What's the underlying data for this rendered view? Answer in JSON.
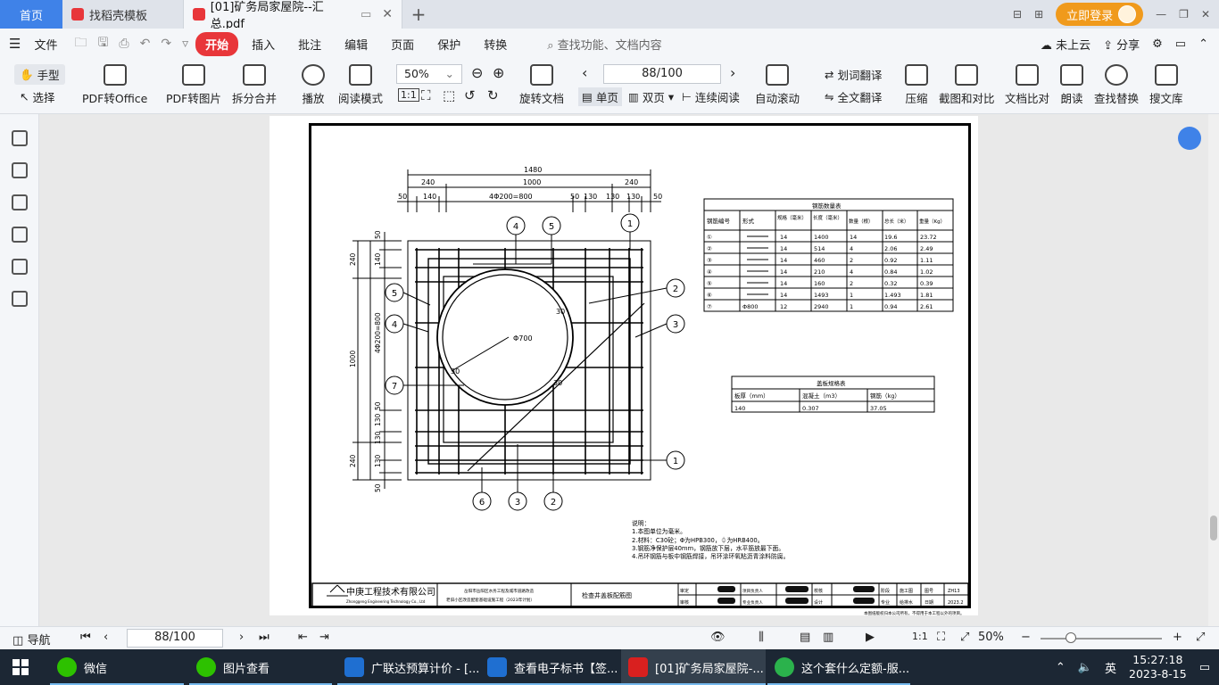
{
  "tabs": {
    "home": "首页",
    "tab1": "找稻壳模板",
    "tab2": "[01]矿务局家屋院--汇总.pdf",
    "login": "立即登录"
  },
  "menu": {
    "file": "文件",
    "items": [
      "开始",
      "插入",
      "批注",
      "编辑",
      "页面",
      "保护",
      "转换"
    ],
    "search": "查找功能、文档内容",
    "cloud": "未上云",
    "share": "分享"
  },
  "toolbar": {
    "hand": "手型",
    "select": "选择",
    "pdf_office": "PDF转Office",
    "pdf_image": "PDF转图片",
    "split": "拆分合并",
    "play": "播放",
    "read_mode": "阅读模式",
    "zoom": "50%",
    "page": "88/100",
    "rotate": "旋转文档",
    "single": "单页",
    "double": "双页",
    "continuous": "连续阅读",
    "autoscroll": "自动滚动",
    "word_trans": "划词翻译",
    "full_trans": "全文翻译",
    "compress": "压缩",
    "screenshot": "截图和对比",
    "compare": "文档比对",
    "read": "朗读",
    "find_replace": "查找替换",
    "search_lib": "搜文库"
  },
  "drawing": {
    "dims_top": {
      "total": "1480",
      "inner": "1000",
      "left240": "240",
      "right240": "240",
      "d50a": "50",
      "d140": "140",
      "spacing": "4Φ200=800",
      "d50b": "50",
      "d130a": "130",
      "d130b": "130",
      "d130c": "130",
      "d50c": "50"
    },
    "dims_left": {
      "d50a": "50",
      "d240a": "240",
      "d140": "140",
      "spacing": "4Φ200=800",
      "d1000": "1000",
      "d50b": "50",
      "d130a": "130",
      "d130b": "130",
      "d240b": "240",
      "d130c": "130",
      "d50c": "50"
    },
    "circle_label": "Φ700",
    "callouts": [
      "1",
      "2",
      "3",
      "4",
      "5",
      "6",
      "7"
    ],
    "diag_label1": "30",
    "diag_label2": "30",
    "diag_label3": "30",
    "rebar_table": {
      "title": "钢筋数量表",
      "headers": [
        "钢筋编号",
        "形式",
        "规格（毫米）",
        "长度（毫米）",
        "数量（根）",
        "总长（米）",
        "重量（Kg）"
      ],
      "rows": [
        [
          "①",
          "",
          "14",
          "1400",
          "14",
          "19.6",
          "23.72"
        ],
        [
          "②",
          "",
          "14",
          "514",
          "4",
          "2.06",
          "2.49"
        ],
        [
          "③",
          "",
          "14",
          "460",
          "2",
          "0.92",
          "1.11"
        ],
        [
          "④",
          "",
          "14",
          "210",
          "4",
          "0.84",
          "1.02"
        ],
        [
          "⑤",
          "",
          "14",
          "160",
          "2",
          "0.32",
          "0.39"
        ],
        [
          "⑥",
          "",
          "14",
          "1493",
          "1",
          "1.493",
          "1.81"
        ],
        [
          "⑦",
          "Φ800",
          "12",
          "2940",
          "1",
          "0.94",
          "2.61"
        ]
      ]
    },
    "cover_table": {
      "title": "盖板规格表",
      "headers": [
        "板厚（mm）",
        "混凝土（m3）",
        "钢筋（kg）"
      ],
      "row": [
        "140",
        "0.307",
        "37.05"
      ]
    },
    "notes": {
      "title": "说明：",
      "lines": [
        "1.本图单位为毫米。",
        "2.材料：C30砼；Φ为HPB300，⏀为HRB400。",
        "3.钢筋净保护层40mm，钢筋放下层，水平筋放最下面。",
        "4.吊环钢筋与板中钢筋焊接，吊环涂环氧粘沥青涂料防腐。"
      ]
    },
    "titleblock": {
      "company": "中庚工程技术有限公司",
      "company_en": "Zhonggeng Engineering Technology Co., Ltd",
      "project1": "岳阳市岳阳区水务工程及城市道路改造",
      "project2": "老旧小区改造配套基础设施工程（2023年计划）",
      "drawing_name": "检查井盖板配筋图",
      "labels": [
        "审定",
        "审核",
        "项目负责人",
        "专业负责人",
        "校核",
        "设计",
        "阶段",
        "专业",
        "图号",
        "日期"
      ],
      "stage": "施工图",
      "spec": "给排水",
      "num": "ZH13",
      "date": "2023.2"
    },
    "corner_note": "本图纸版权归本公司所有，不得用于本工程以外的项目。"
  },
  "status": {
    "nav": "导航",
    "page": "88/100",
    "zoom": "50%"
  },
  "taskbar": {
    "apps": [
      "微信",
      "图片查看",
      "广联达预算计价 - [...",
      "查看电子标书【签...",
      "[01]矿务局家屋院-...",
      "这个套什么定额-服..."
    ],
    "lang": "英",
    "time": "15:27:18",
    "date": "2023-8-15"
  },
  "colors": {
    "accent": "#e8363a",
    "home_tab": "#3f82e8",
    "login": "#f09a1c",
    "wps_red": "#d9201f"
  }
}
